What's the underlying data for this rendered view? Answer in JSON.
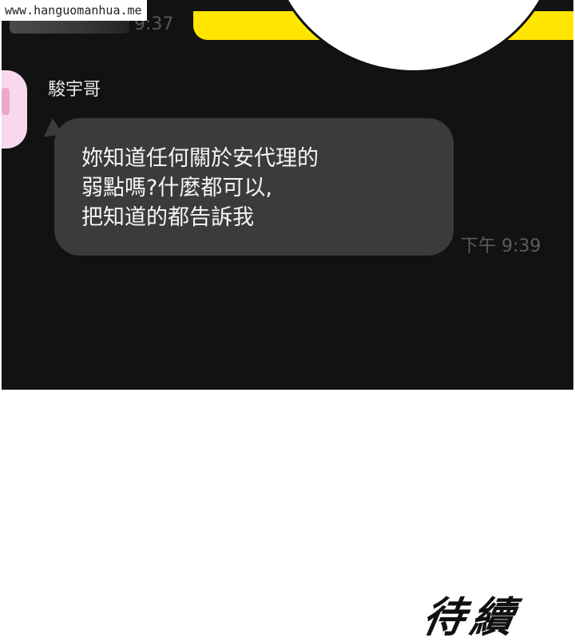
{
  "watermark": "www.hanguomanhua.me",
  "chat": {
    "previous_time": "9:37",
    "sender": "駿宇哥",
    "message_lines": [
      "妳知道任何關於安代理的",
      "弱點嗎?什麼都可以,",
      "把知道的都告訴我"
    ],
    "message_time": "下午 9:39"
  },
  "footer": {
    "continued_text": "待續"
  },
  "colors": {
    "screen_background": "#121212",
    "bubble_background": "#3b3b3b",
    "yellow_bubble": "#ffe600",
    "avatar_pink": "#f7d8ec"
  }
}
